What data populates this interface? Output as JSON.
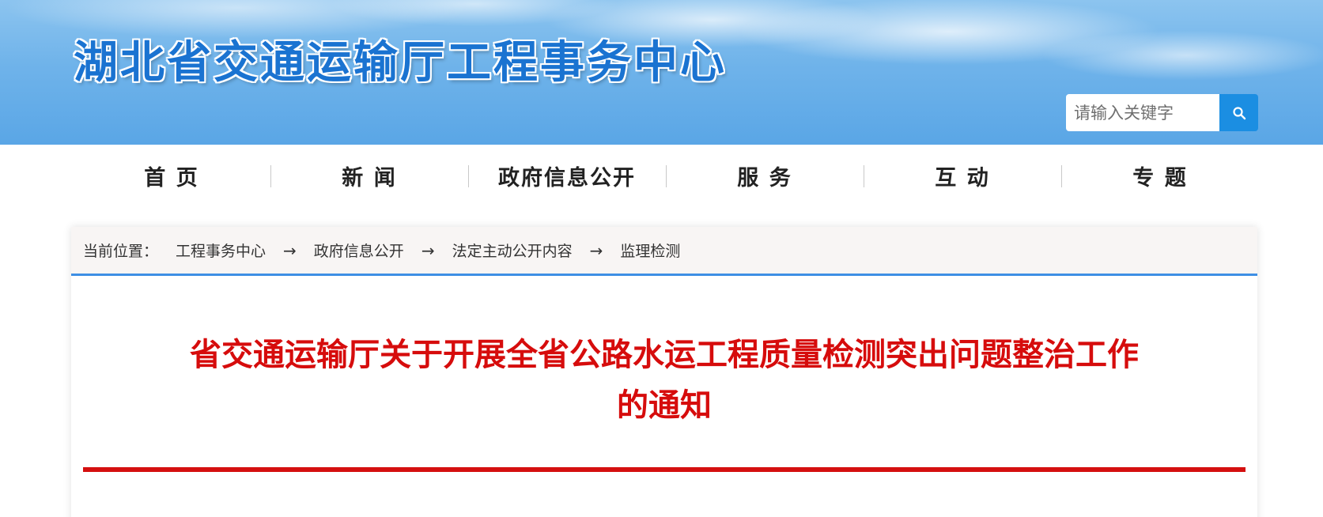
{
  "header": {
    "site_title": "湖北省交通运输厅工程事务中心",
    "search_placeholder": "请输入关键字"
  },
  "nav": {
    "items": [
      "首 页",
      "新 闻",
      "政府信息公开",
      "服 务",
      "互 动",
      "专 题"
    ]
  },
  "breadcrumb": {
    "label": "当前位置：",
    "items": [
      "工程事务中心",
      "政府信息公开",
      "法定主动公开内容",
      "监理检测"
    ],
    "separator": "→"
  },
  "article": {
    "title_line1": "省交通运输厅关于开展全省公路水运工程质量检测突出问题整治工作",
    "title_line2": "的通知"
  },
  "colors": {
    "title_red": "#d60c0c",
    "search_button": "#1b8ee2",
    "breadcrumb_border": "#3e8fe4"
  }
}
